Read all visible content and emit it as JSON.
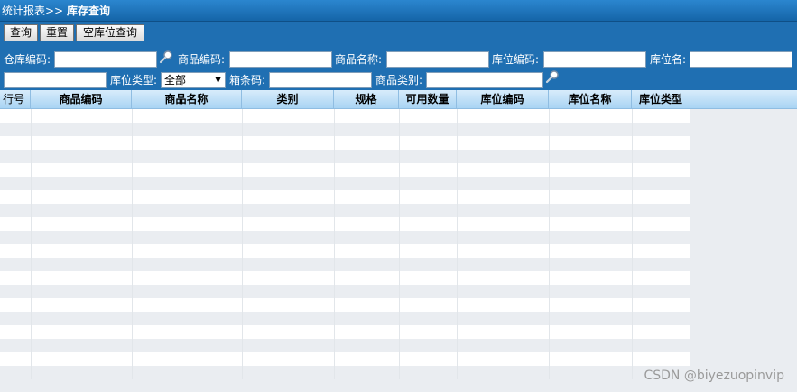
{
  "breadcrumb": {
    "parent": "统计报表>>",
    "current": "库存查询"
  },
  "toolbar": {
    "query_label": "查询",
    "reset_label": "重置",
    "empty_location_label": "空库位查询"
  },
  "filters": {
    "warehouse_code": {
      "label": "仓库编码:",
      "value": ""
    },
    "product_code": {
      "label": "商品编码:",
      "value": ""
    },
    "product_name": {
      "label": "商品名称:",
      "value": ""
    },
    "location_code": {
      "label": "库位编码:",
      "value": ""
    },
    "location_name": {
      "label": "库位名:",
      "value": ""
    },
    "location_type": {
      "label": "库位类型:",
      "selected": "全部"
    },
    "box_barcode": {
      "label": "箱条码:",
      "value": ""
    },
    "product_category": {
      "label": "商品类别:",
      "value": ""
    }
  },
  "grid": {
    "columns": [
      "行号",
      "商品编码",
      "商品名称",
      "类别",
      "规格",
      "可用数量",
      "库位编码",
      "库位名称",
      "库位类型"
    ],
    "rows": []
  },
  "watermark": "CSDN @biyezuopinvip",
  "colors": {
    "header_blue": "#1f6fb2",
    "grid_header": "#a9d4f3",
    "row_alt": "#eaedf1"
  }
}
